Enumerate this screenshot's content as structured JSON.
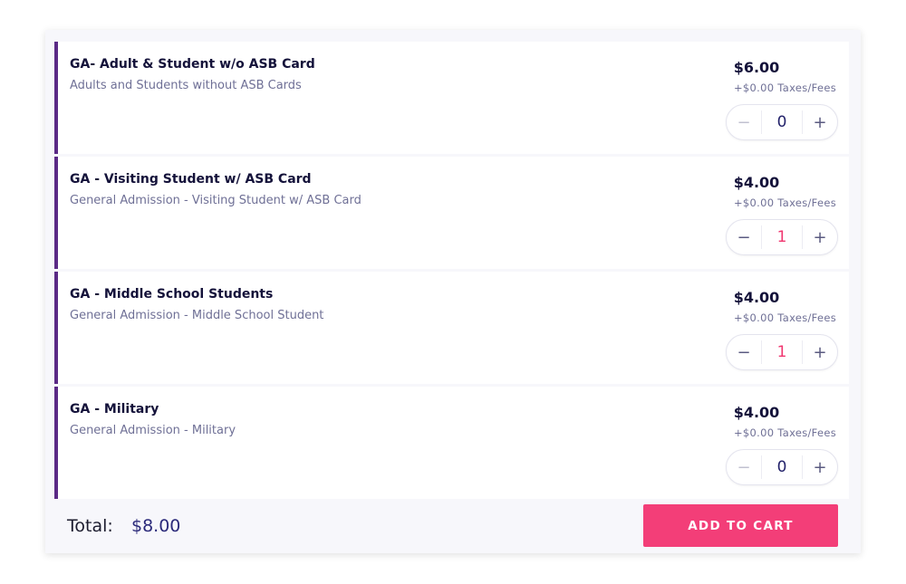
{
  "tickets": [
    {
      "title": "GA- Adult & Student w/o ASB Card",
      "description": "Adults and Students without ASB Cards",
      "price": "$6.00",
      "fees": "+$0.00 Taxes/Fees",
      "quantity": "0",
      "minus": "−",
      "plus": "+"
    },
    {
      "title": "GA - Visiting Student w/ ASB Card",
      "description": "General Admission - Visiting Student w/ ASB Card",
      "price": "$4.00",
      "fees": "+$0.00 Taxes/Fees",
      "quantity": "1",
      "minus": "−",
      "plus": "+"
    },
    {
      "title": "GA - Middle School Students",
      "description": "General Admission - Middle School Student",
      "price": "$4.00",
      "fees": "+$0.00 Taxes/Fees",
      "quantity": "1",
      "minus": "−",
      "plus": "+"
    },
    {
      "title": "GA - Military",
      "description": "General Admission - Military",
      "price": "$4.00",
      "fees": "+$0.00 Taxes/Fees",
      "quantity": "0",
      "minus": "−",
      "plus": "+"
    }
  ],
  "footer": {
    "total_label": "Total:",
    "total_value": "$8.00",
    "add_to_cart": "ADD TO CART"
  },
  "colors": {
    "accent": "#5b2a86",
    "button": "#f33e78",
    "active_qty": "#f0366f"
  }
}
